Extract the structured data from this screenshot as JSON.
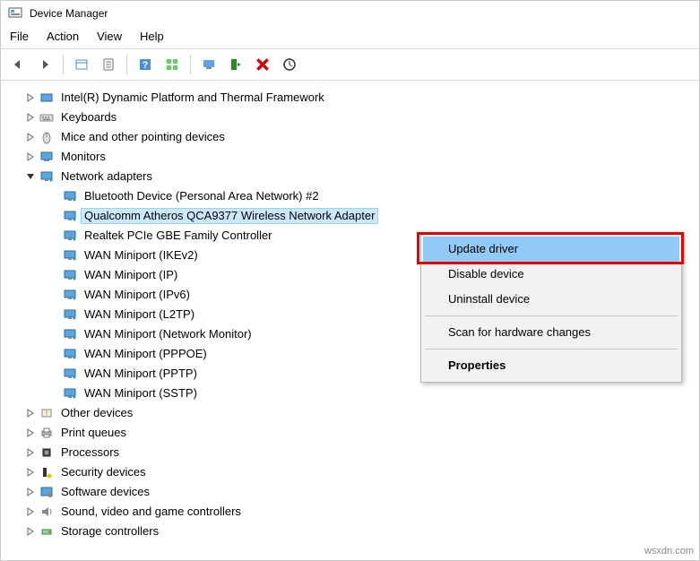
{
  "titlebar": {
    "title": "Device Manager"
  },
  "menubar": {
    "file": "File",
    "action": "Action",
    "view": "View",
    "help": "Help"
  },
  "tree": {
    "categories": [
      {
        "expand": "closed",
        "icon": "platform",
        "label": "Intel(R) Dynamic Platform and Thermal Framework"
      },
      {
        "expand": "closed",
        "icon": "keyboard",
        "label": "Keyboards"
      },
      {
        "expand": "closed",
        "icon": "mouse",
        "label": "Mice and other pointing devices"
      },
      {
        "expand": "closed",
        "icon": "monitor",
        "label": "Monitors"
      },
      {
        "expand": "open",
        "icon": "network",
        "label": "Network adapters",
        "children": [
          {
            "label": "Bluetooth Device (Personal Area Network) #2"
          },
          {
            "label": "Qualcomm Atheros QCA9377 Wireless Network Adapter",
            "selected": true
          },
          {
            "label": "Realtek PCIe GBE Family Controller"
          },
          {
            "label": "WAN Miniport (IKEv2)"
          },
          {
            "label": "WAN Miniport (IP)"
          },
          {
            "label": "WAN Miniport (IPv6)"
          },
          {
            "label": "WAN Miniport (L2TP)"
          },
          {
            "label": "WAN Miniport (Network Monitor)"
          },
          {
            "label": "WAN Miniport (PPPOE)"
          },
          {
            "label": "WAN Miniport (PPTP)"
          },
          {
            "label": "WAN Miniport (SSTP)"
          }
        ]
      },
      {
        "expand": "closed",
        "icon": "other",
        "label": "Other devices"
      },
      {
        "expand": "closed",
        "icon": "printer",
        "label": "Print queues"
      },
      {
        "expand": "closed",
        "icon": "cpu",
        "label": "Processors"
      },
      {
        "expand": "closed",
        "icon": "security",
        "label": "Security devices"
      },
      {
        "expand": "closed",
        "icon": "software",
        "label": "Software devices"
      },
      {
        "expand": "closed",
        "icon": "sound",
        "label": "Sound, video and game controllers"
      },
      {
        "expand": "closed",
        "icon": "storage",
        "label": "Storage controllers"
      }
    ]
  },
  "context_menu": {
    "items": [
      {
        "label": "Update driver",
        "highlighted": true
      },
      {
        "label": "Disable device"
      },
      {
        "label": "Uninstall device"
      },
      {
        "sep": true
      },
      {
        "label": "Scan for hardware changes"
      },
      {
        "sep": true
      },
      {
        "label": "Properties",
        "bold": true
      }
    ]
  },
  "watermark": "wsxdn.com"
}
